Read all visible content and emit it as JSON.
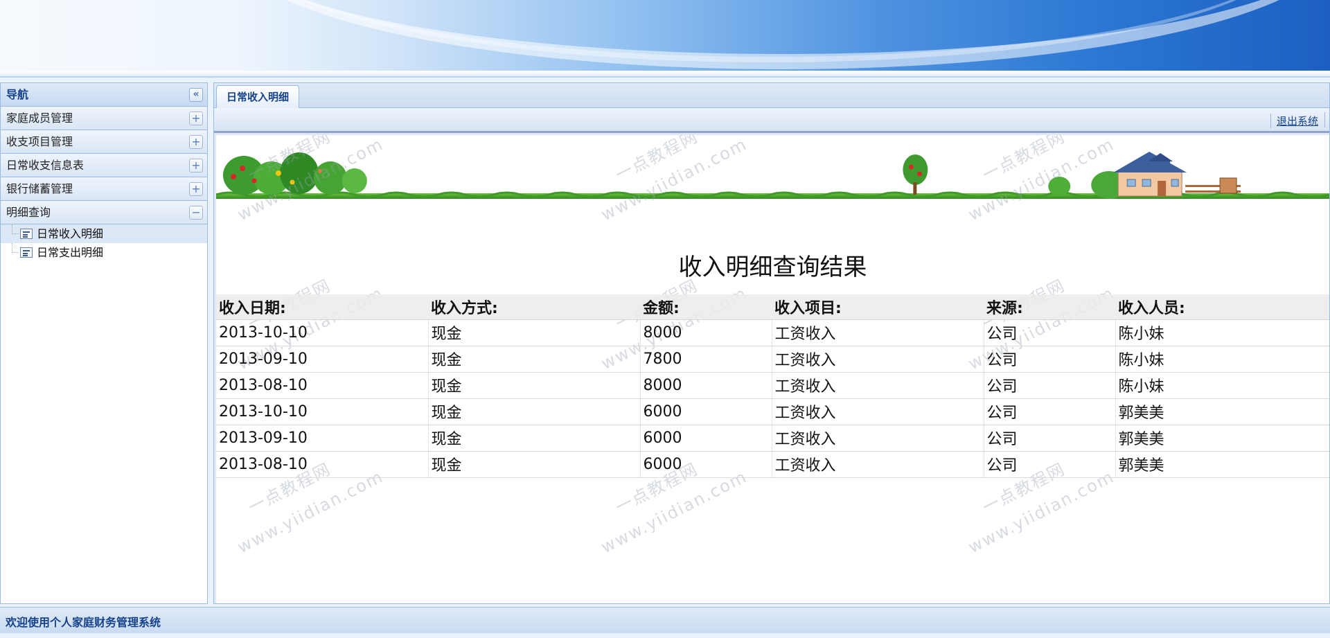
{
  "nav": {
    "title": "导航",
    "collapse_icon": "double-chevron-left-icon",
    "sections": [
      {
        "label": "家庭成员管理",
        "toggle": "+"
      },
      {
        "label": "收支项目管理",
        "toggle": "+"
      },
      {
        "label": "日常收支信息表",
        "toggle": "+"
      },
      {
        "label": "银行储蓄管理",
        "toggle": "+"
      },
      {
        "label": "明细查询",
        "toggle": "−"
      }
    ],
    "tree_items": [
      {
        "label": "日常收入明细",
        "selected": true
      },
      {
        "label": "日常支出明细",
        "selected": false
      }
    ]
  },
  "tabs": [
    {
      "label": "日常收入明细"
    }
  ],
  "toolbar": {
    "logout_label": "退出系统"
  },
  "content": {
    "title": "收入明细查询结果",
    "columns": [
      "收入日期:",
      "收入方式:",
      "金额:",
      "收入项目:",
      "来源:",
      "收入人员:"
    ],
    "rows": [
      [
        "2013-10-10",
        "现金",
        "8000",
        "工资收入",
        "公司",
        "陈小妹"
      ],
      [
        "2013-09-10",
        "现金",
        "7800",
        "工资收入",
        "公司",
        "陈小妹"
      ],
      [
        "2013-08-10",
        "现金",
        "8000",
        "工资收入",
        "公司",
        "陈小妹"
      ],
      [
        "2013-10-10",
        "现金",
        "6000",
        "工资收入",
        "公司",
        "郭美美"
      ],
      [
        "2013-09-10",
        "现金",
        "6000",
        "工资收入",
        "公司",
        "郭美美"
      ],
      [
        "2013-08-10",
        "现金",
        "6000",
        "工资收入",
        "公司",
        "郭美美"
      ]
    ],
    "watermark": {
      "line1": "一点教程网",
      "line2": "www.yiidian.com"
    }
  },
  "statusbar": {
    "text": "欢迎使用个人家庭财务管理系统"
  },
  "colors": {
    "accent": "#15428b",
    "panel_border": "#99bbe8"
  }
}
